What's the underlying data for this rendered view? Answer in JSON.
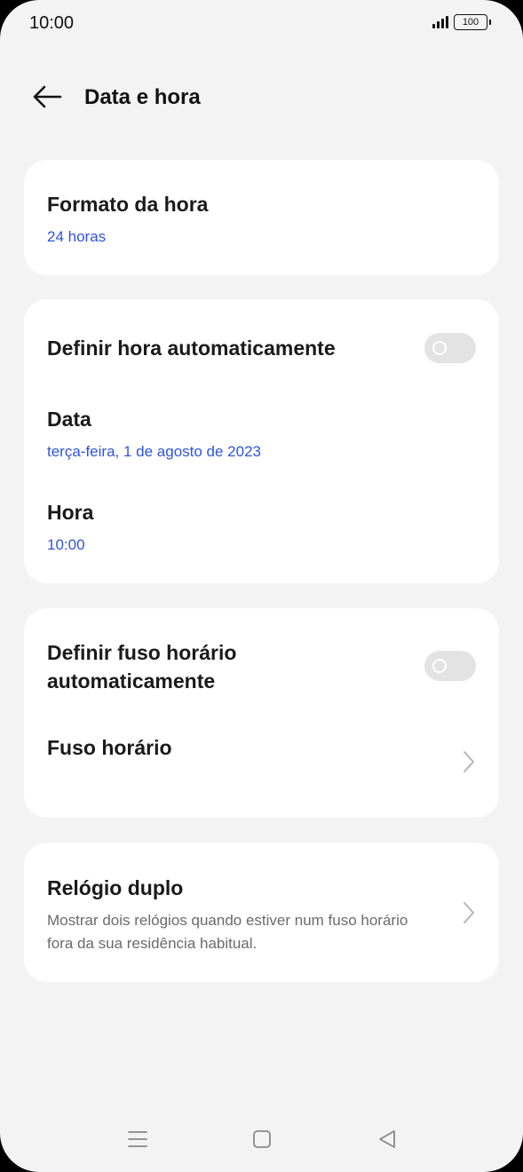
{
  "status": {
    "time": "10:00",
    "battery": "100"
  },
  "header": {
    "title": "Data e hora"
  },
  "time_format": {
    "title": "Formato da hora",
    "value": "24 horas"
  },
  "auto_time": {
    "title": "Definir hora automaticamente",
    "enabled": false
  },
  "date": {
    "title": "Data",
    "value": "terça-feira, 1 de agosto de 2023"
  },
  "time": {
    "title": "Hora",
    "value": "10:00"
  },
  "auto_timezone": {
    "title": "Definir fuso horário automaticamente",
    "enabled": false
  },
  "timezone": {
    "title": "Fuso horário"
  },
  "dual_clock": {
    "title": "Relógio duplo",
    "description": "Mostrar dois relógios quando estiver num fuso horário fora da sua residência habitual."
  },
  "colors": {
    "accent": "#2f54d6",
    "background": "#f3f3f3",
    "card": "#ffffff",
    "toggle_off": "#e3e3e3"
  },
  "icons": {
    "back": "arrow-left-icon",
    "chevron": "chevron-right-icon",
    "nav_menu": "menu-icon",
    "nav_home": "home-square-icon",
    "nav_back": "triangle-back-icon"
  }
}
